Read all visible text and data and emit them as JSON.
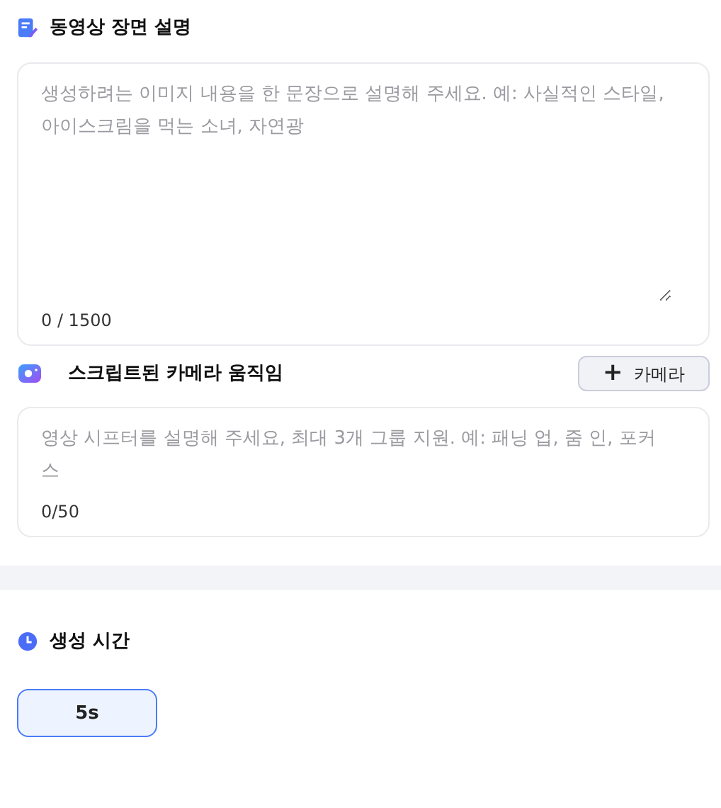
{
  "scene": {
    "title": "동영상 장면 설명",
    "placeholder": "생성하려는 이미지 내용을 한 문장으로 설명해 주세요. 예: 사실적인 스타일, 아이스크림을 먹는 소녀, 자연광",
    "counter": "0 / 1500"
  },
  "camera": {
    "title": "스크립트된 카메라 움직임",
    "add_button": {
      "icon": "+",
      "label": "카메라"
    },
    "placeholder": "영상 시프터를 설명해 주세요, 최대 3개 그룹 지원. 예: 패닝 업, 줌 인, 포커스",
    "counter": "0/50"
  },
  "duration": {
    "title": "생성 시간",
    "options": [
      {
        "label": "5s",
        "selected": true
      }
    ]
  }
}
